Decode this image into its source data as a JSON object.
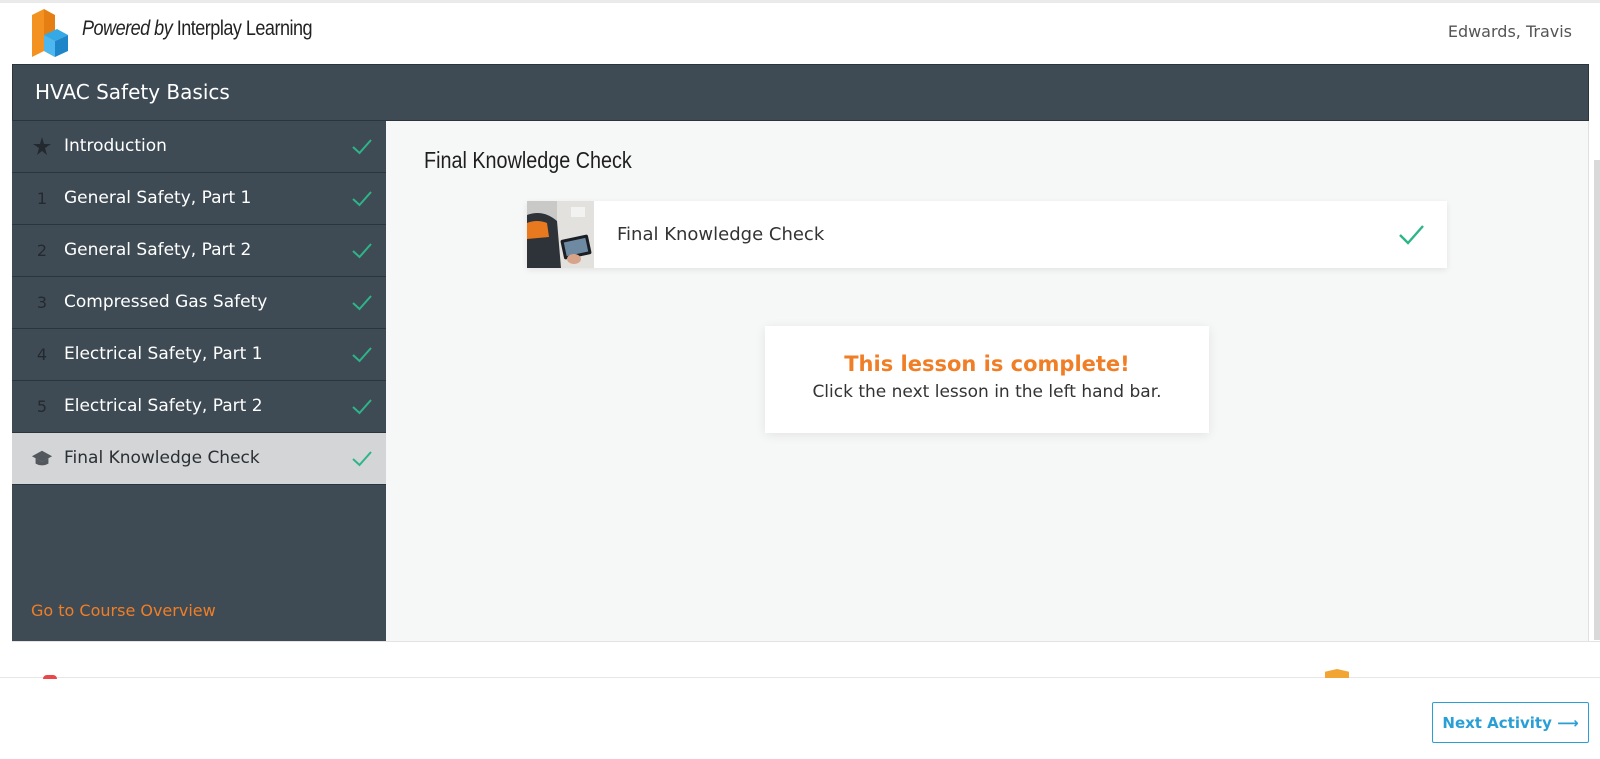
{
  "header": {
    "brand_prefix": "Powered by",
    "brand_name": "Interplay Learning",
    "user_name": "Edwards, Travis",
    "logo_icon": "interplay-cube-logo"
  },
  "course": {
    "title": "HVAC Safety Basics"
  },
  "sidebar": {
    "lessons": [
      {
        "marker": "star-icon",
        "label": "Introduction",
        "completed": true
      },
      {
        "marker": "1",
        "label": "General Safety, Part 1",
        "completed": true
      },
      {
        "marker": "2",
        "label": "General Safety, Part 2",
        "completed": true
      },
      {
        "marker": "3",
        "label": "Compressed Gas Safety",
        "completed": true
      },
      {
        "marker": "4",
        "label": "Electrical Safety, Part 1",
        "completed": true
      },
      {
        "marker": "5",
        "label": "Electrical Safety, Part 2",
        "completed": true
      },
      {
        "marker": "graduation-cap-icon",
        "label": "Final Knowledge Check",
        "completed": true,
        "active": true
      }
    ],
    "overview_link": "Go to Course Overview"
  },
  "main": {
    "title": "Final Knowledge Check",
    "activity": {
      "label": "Final Knowledge Check",
      "completed": true
    },
    "completion": {
      "title": "This lesson is complete!",
      "message": "Click the next lesson in the left hand bar."
    }
  },
  "footer": {
    "next_button": "Next Activity ⟶"
  },
  "colors": {
    "sidebar_bg": "#3f4b54",
    "accent_orange": "#f07e26",
    "check_green": "#2db589",
    "button_blue": "#2a9fd6"
  }
}
